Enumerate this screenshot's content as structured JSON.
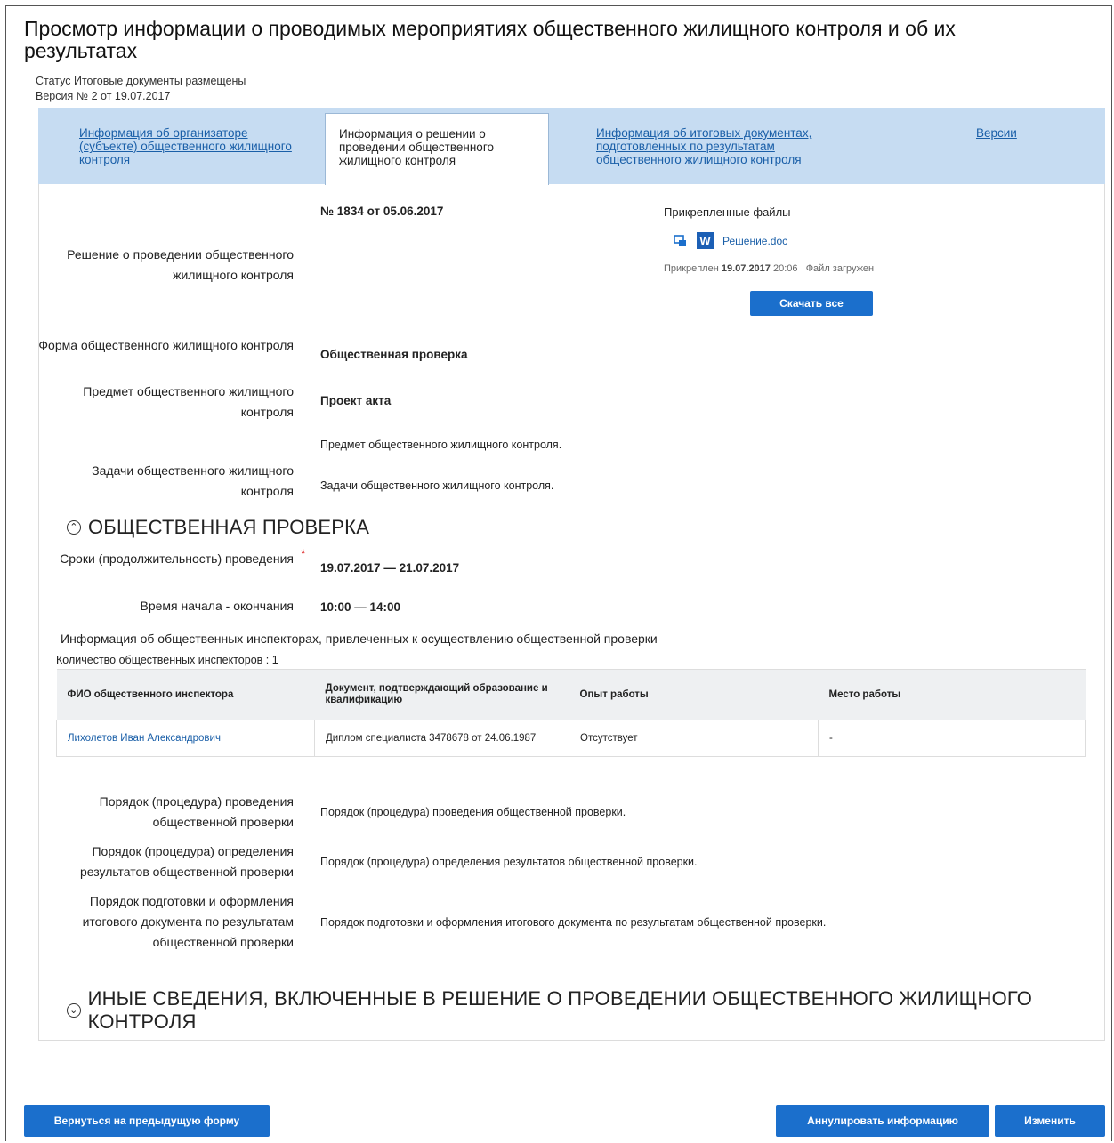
{
  "page": {
    "title": "Просмотр информации о проводимых мероприятиях общественного жилищного контроля и об их результатах",
    "status": "Статус Итоговые документы размещены",
    "version": "Версия № 2 от 19.07.2017"
  },
  "tabs": [
    {
      "label": "Информация об организаторе (субъекте) общественного жилищного контроля"
    },
    {
      "label": "Информация о решении о проведении общественного жилищного контроля"
    },
    {
      "label": "Информация об итоговых документах, подготовленных по результатам общественного жилищного контроля"
    },
    {
      "label": "Версии"
    }
  ],
  "decision": {
    "label": "Решение о проведении общественного жилищного контроля",
    "number": "№ 1834 от 05.06.2017",
    "files_title": "Прикрепленные файлы",
    "file_icon_letter": "W",
    "file_name": "Решение.doc",
    "attached_prefix": "Прикреплен",
    "attached_date": "19.07.2017",
    "attached_time": "20:06",
    "file_status": "Файл загружен",
    "download_all": "Скачать все"
  },
  "fields": {
    "form_label": "Форма общественного жилищного контроля",
    "form_value": "Общественная проверка",
    "subject_label": "Предмет общественного жилищного контроля",
    "subject_value": "Проект акта",
    "subject_text": "Предмет общественного жилищного контроля.",
    "tasks_label": "Задачи общественного жилищного контроля",
    "tasks_value": "Задачи общественного жилищного контроля."
  },
  "inspection": {
    "heading": "ОБЩЕСТВЕННАЯ ПРОВЕРКА",
    "terms_label": "Сроки (продолжительность) проведения",
    "terms_value": "19.07.2017 — 21.07.2017",
    "time_label": "Время начала - окончания",
    "time_value": "10:00 — 14:00",
    "inspectors_info": "Информация об общественных инспекторах, привлеченных к осуществлению общественной проверки",
    "inspectors_count": "Количество общественных инспекторов : 1",
    "table": {
      "headers": [
        "ФИО общественного инспектора",
        "Документ, подтверждающий образование и квалификацию",
        "Опыт работы",
        "Место работы"
      ],
      "rows": [
        [
          "Лихолетов Иван Александрович",
          "Диплом специалиста 3478678 от 24.06.1987",
          "Отсутствует",
          "-"
        ]
      ]
    },
    "procedure_label": "Порядок (процедура) проведения общественной проверки",
    "procedure_value": "Порядок (процедура) проведения общественной проверки.",
    "results_label": "Порядок (процедура) определения результатов общественной проверки",
    "results_value": "Порядок (процедура) определения результатов общественной проверки.",
    "docs_label": "Порядок подготовки и оформления итогового документа по результатам общественной проверки",
    "docs_value": "Порядок подготовки и оформления итогового документа по результатам общественной проверки."
  },
  "other": {
    "heading": "ИНЫЕ СВЕДЕНИЯ, ВКЛЮЧЕННЫЕ В РЕШЕНИЕ О ПРОВЕДЕНИИ ОБЩЕСТВЕННОГО ЖИЛИЩНОГО КОНТРОЛЯ"
  },
  "buttons": {
    "back": "Вернуться на предыдущую форму",
    "annul": "Аннулировать информацию",
    "edit": "Изменить"
  }
}
